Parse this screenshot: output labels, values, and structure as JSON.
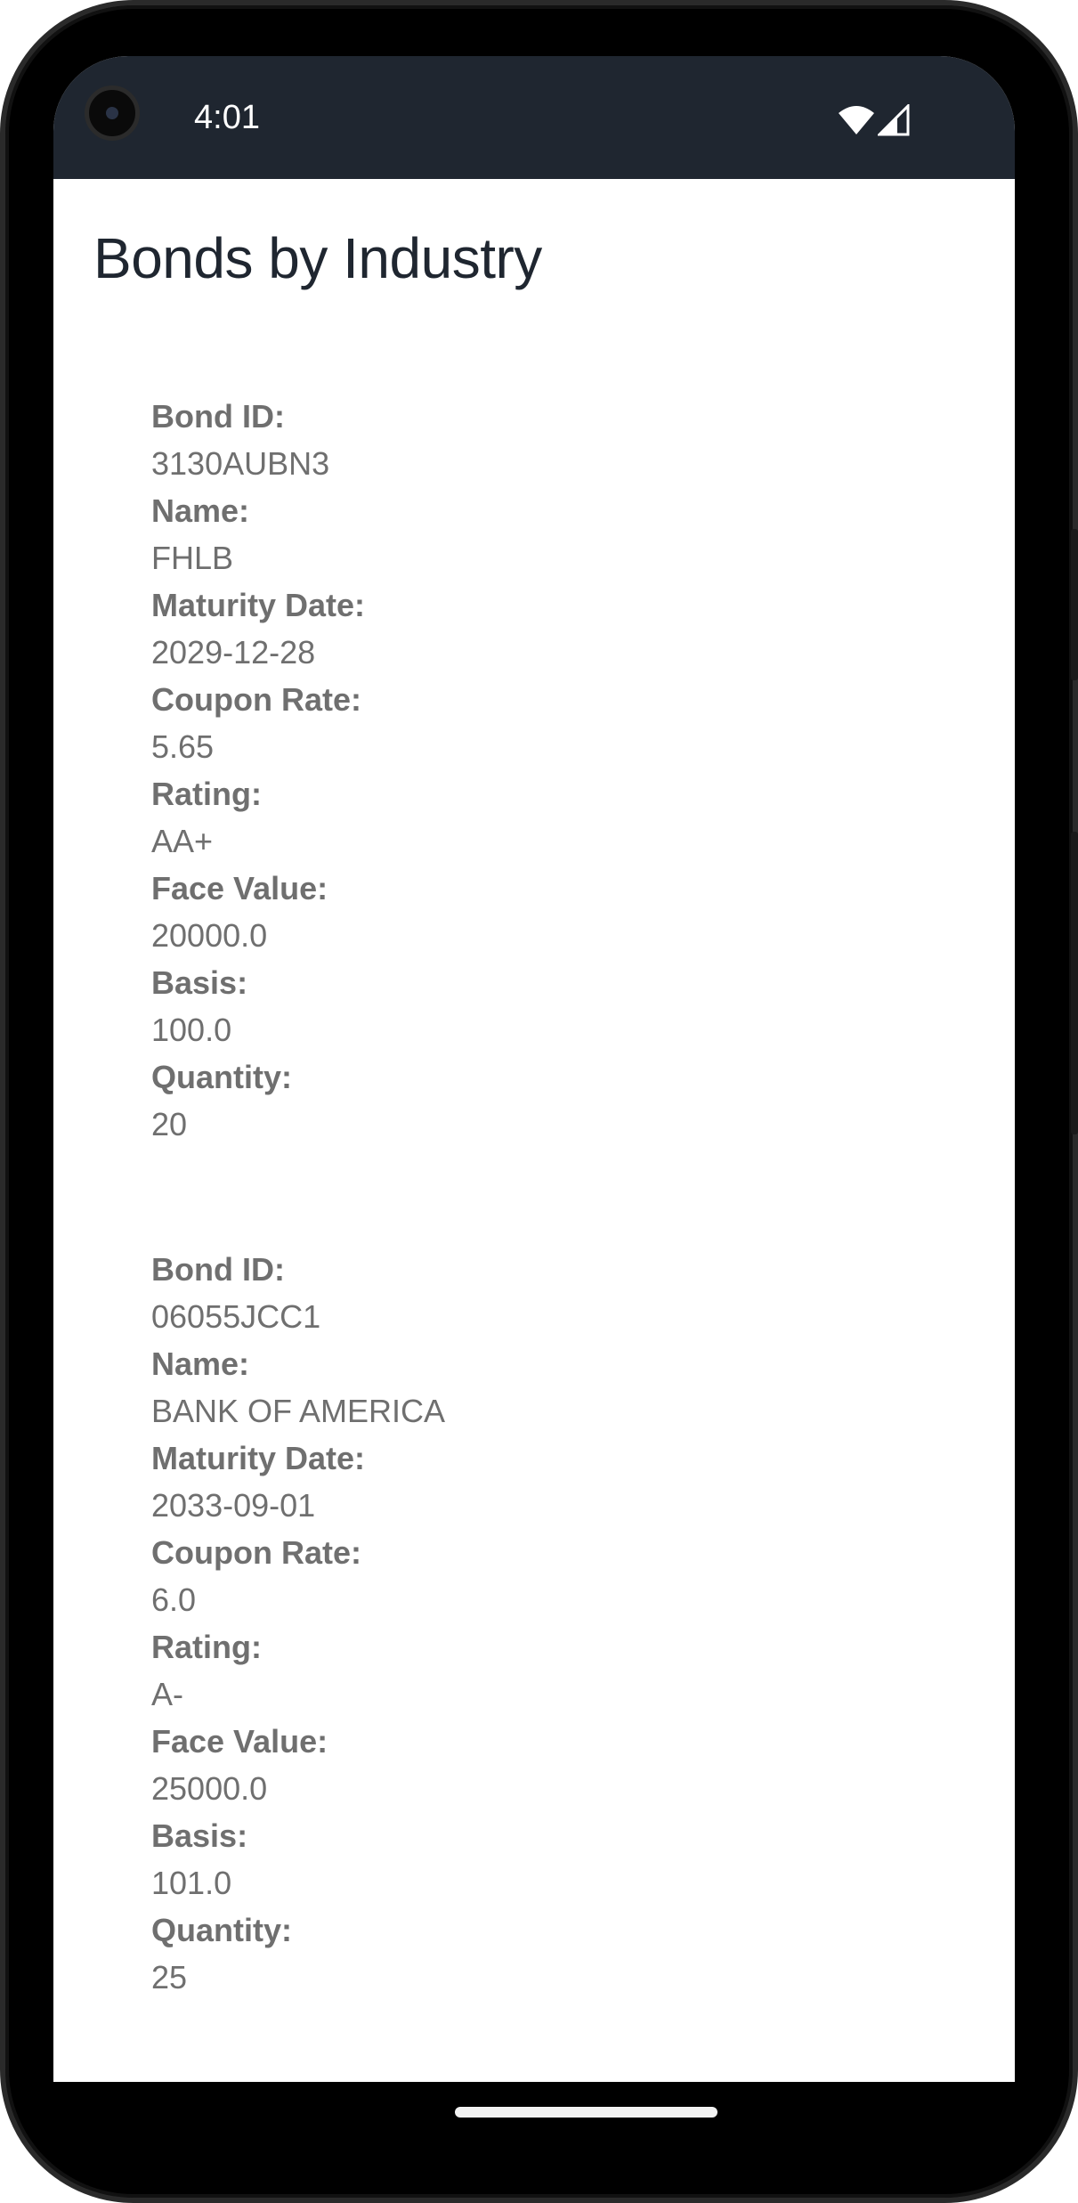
{
  "status_bar": {
    "time": "4:01",
    "icons": [
      "wifi-icon",
      "cell-signal-icon"
    ]
  },
  "page": {
    "title": "Bonds by Industry"
  },
  "labels": {
    "bond_id": "Bond ID:",
    "name": "Name:",
    "maturity_date": "Maturity Date:",
    "coupon_rate": "Coupon Rate:",
    "rating": "Rating:",
    "face_value": "Face Value:",
    "basis": "Basis:",
    "quantity": "Quantity:"
  },
  "bonds": [
    {
      "bond_id": "3130AUBN3",
      "name": "FHLB",
      "maturity_date": "2029-12-28",
      "coupon_rate": "5.65",
      "rating": "AA+",
      "face_value": "20000.0",
      "basis": "100.0",
      "quantity": "20"
    },
    {
      "bond_id": "06055JCC1",
      "name": "BANK OF AMERICA",
      "maturity_date": "2033-09-01",
      "coupon_rate": "6.0",
      "rating": "A-",
      "face_value": "25000.0",
      "basis": "101.0",
      "quantity": "25"
    }
  ],
  "colors": {
    "status_bar_bg": "#1f2630",
    "title_text": "#1f2630",
    "field_text": "#6f6f6f",
    "screen_bg": "#ffffff",
    "frame": "#000000"
  }
}
